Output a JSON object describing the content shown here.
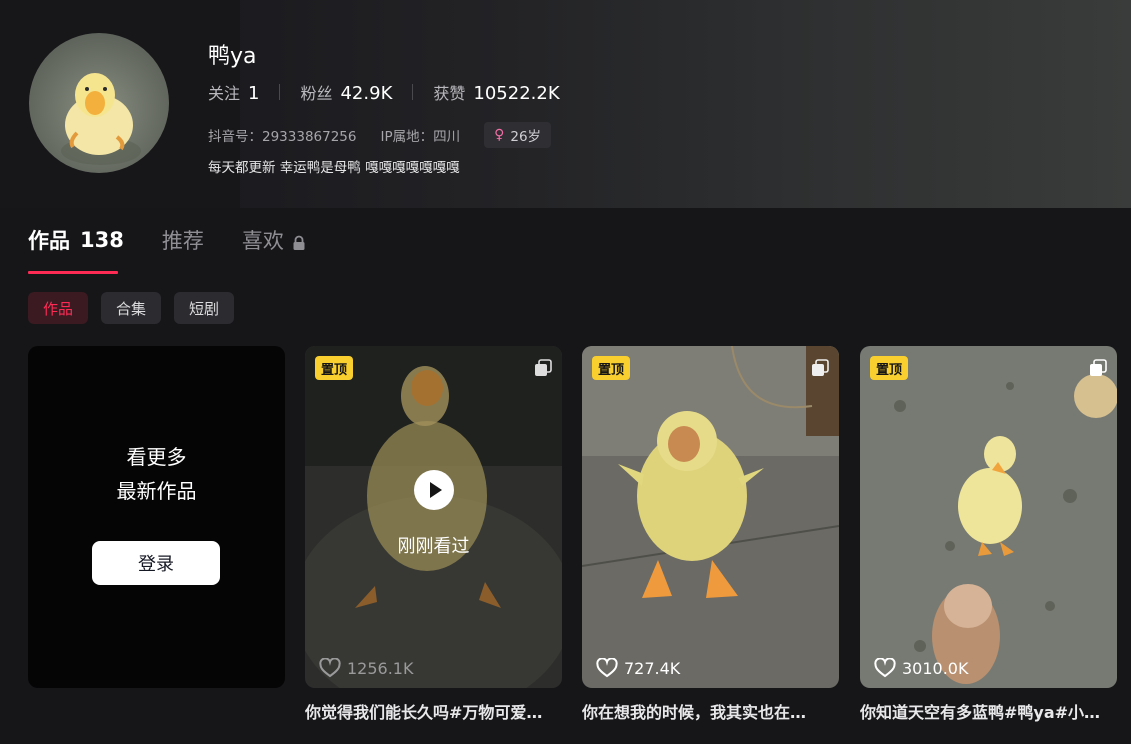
{
  "profile": {
    "name": "鸭ya",
    "stats": [
      {
        "label": "关注",
        "value": "1"
      },
      {
        "label": "粉丝",
        "value": "42.9K"
      },
      {
        "label": "获赞",
        "value": "10522.2K"
      }
    ],
    "douyin_id": "抖音号：29333867256",
    "ip_location": "IP属地：四川",
    "age": "26岁",
    "bio": "每天都更新 幸运鸭是母鸭 嘎嘎嘎嘎嘎嘎嘎"
  },
  "tabs": [
    {
      "label": "作品",
      "count": "138"
    },
    {
      "label": "推荐"
    },
    {
      "label": "喜欢"
    }
  ],
  "chips": [
    "作品",
    "合集",
    "短剧"
  ],
  "login_card": {
    "line1": "看更多",
    "line2": "最新作品",
    "button": "登录"
  },
  "videos": [
    {
      "pin": "置顶",
      "likes": "1256.1K",
      "overlay": "刚刚看过",
      "caption": "你觉得我们能长久吗#万物可爱…"
    },
    {
      "pin": "置顶",
      "likes": "727.4K",
      "caption": "你在想我的时候，我其实也在…"
    },
    {
      "pin": "置顶",
      "likes": "3010.0K",
      "caption": "你知道天空有多蓝鸭#鸭ya#小…"
    }
  ],
  "colors": {
    "accent": "#fe2c55",
    "pin_badge": "#f8cf2e",
    "background": "#161619"
  },
  "icons": [
    "lock-icon",
    "heart-icon",
    "play-icon",
    "multi-image-icon",
    "female-icon"
  ]
}
